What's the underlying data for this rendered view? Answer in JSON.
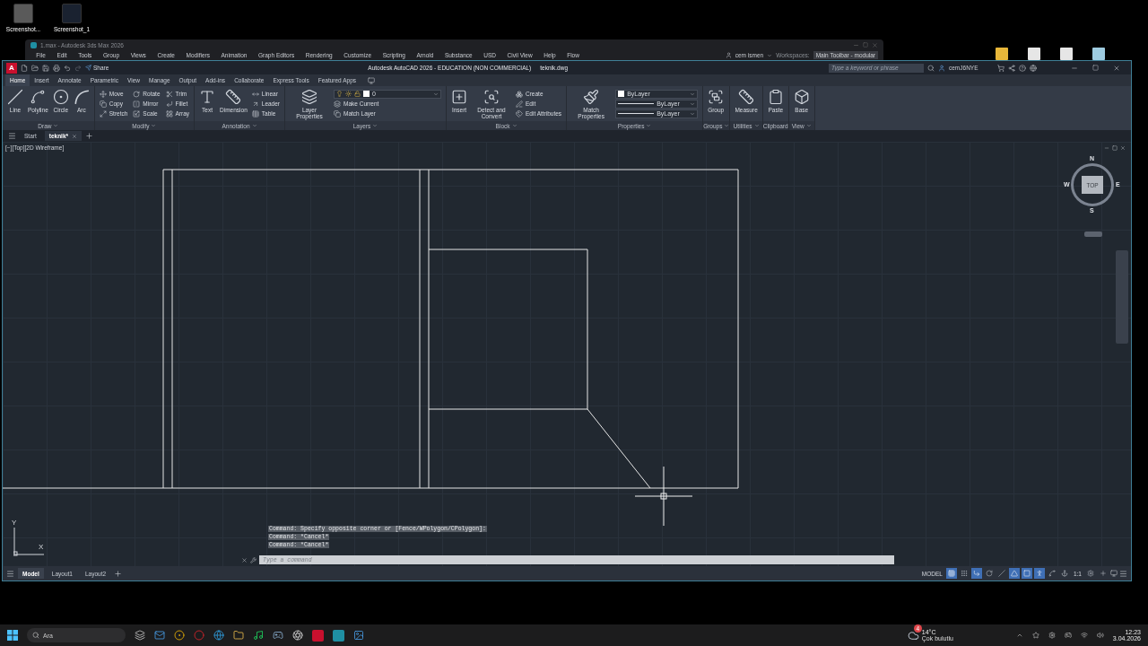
{
  "desktop_icons": [
    {
      "label": "Screenshot..."
    },
    {
      "label": "Screenshot_1"
    }
  ],
  "background_window": {
    "title": "1.max - Autodesk 3ds Max 2026",
    "menu": [
      "File",
      "Edit",
      "Tools",
      "Group",
      "Views",
      "Create",
      "Modifiers",
      "Animation",
      "Graph Editors",
      "Rendering",
      "Customize",
      "Scripting",
      "Arnold",
      "Substance",
      "USD",
      "Civil View",
      "Help",
      "Flow"
    ],
    "user": "cem ismen",
    "workspaces_label": "Workspaces:",
    "workspace": "Main Toolbar - modular"
  },
  "window": {
    "logo": "A",
    "share": "Share",
    "title": "Autodesk AutoCAD 2026 - EDUCATION (NON COMMERCIAL)",
    "file": "teknik.dwg",
    "search": {
      "placeholder": "Type a keyword or phrase"
    },
    "user": "cemJ6NYE"
  },
  "ribbon_tabs": [
    {
      "label": "Home",
      "selected": true
    },
    {
      "label": "Insert",
      "selected": false
    },
    {
      "label": "Annotate",
      "selected": false
    },
    {
      "label": "Parametric",
      "selected": false
    },
    {
      "label": "View",
      "selected": false
    },
    {
      "label": "Manage",
      "selected": false
    },
    {
      "label": "Output",
      "selected": false
    },
    {
      "label": "Add-ins",
      "selected": false
    },
    {
      "label": "Collaborate",
      "selected": false
    },
    {
      "label": "Express Tools",
      "selected": false
    },
    {
      "label": "Featured Apps",
      "selected": false
    }
  ],
  "ribbon_panels": [
    {
      "title": "Draw",
      "dropdown": true,
      "tools": [
        {
          "kind": "large",
          "label": "Line"
        },
        {
          "kind": "large",
          "label": "Polyline"
        },
        {
          "kind": "large",
          "label": "Circle"
        },
        {
          "kind": "large",
          "label": "Arc"
        }
      ]
    },
    {
      "title": "Modify",
      "dropdown": true,
      "tools": [
        {
          "kind": "small",
          "label": "Move"
        },
        {
          "kind": "small",
          "label": "Copy"
        },
        {
          "kind": "small",
          "label": "Stretch"
        },
        {
          "kind": "small",
          "label": "Rotate"
        },
        {
          "kind": "small",
          "label": "Mirror"
        },
        {
          "kind": "small",
          "label": "Scale"
        },
        {
          "kind": "small",
          "label": "Trim"
        },
        {
          "kind": "small",
          "label": "Fillet"
        },
        {
          "kind": "small",
          "label": "Array"
        }
      ]
    },
    {
      "title": "Annotation",
      "dropdown": true,
      "tools": [
        {
          "kind": "large",
          "label": "Text"
        },
        {
          "kind": "large",
          "label": "Dimension"
        },
        {
          "kind": "small",
          "label": "Linear"
        },
        {
          "kind": "small",
          "label": "Leader"
        },
        {
          "kind": "small",
          "label": "Table"
        }
      ]
    },
    {
      "title": "Layers",
      "dropdown": true,
      "tools": [
        {
          "kind": "large",
          "label": "Layer Properties"
        },
        {
          "kind": "combo",
          "value": "0"
        },
        {
          "kind": "small",
          "label": "Make Current"
        },
        {
          "kind": "small",
          "label": "Match Layer"
        }
      ]
    },
    {
      "title": "Block",
      "dropdown": true,
      "tools": [
        {
          "kind": "large",
          "label": "Insert"
        },
        {
          "kind": "large",
          "label": "Detect and Convert"
        },
        {
          "kind": "small",
          "label": "Create"
        },
        {
          "kind": "small",
          "label": "Edit"
        },
        {
          "kind": "small",
          "label": "Edit Attributes"
        }
      ]
    },
    {
      "title": "Properties",
      "dropdown": true,
      "tools": [
        {
          "kind": "large",
          "label": "Match Properties"
        },
        {
          "kind": "combo",
          "value": "ByLayer"
        },
        {
          "kind": "combo",
          "value": "ByLayer"
        },
        {
          "kind": "combo",
          "value": "ByLayer"
        }
      ]
    },
    {
      "title": "Groups",
      "dropdown": true,
      "tools": [
        {
          "kind": "large",
          "label": "Group"
        }
      ]
    },
    {
      "title": "Utilities",
      "dropdown": true,
      "tools": [
        {
          "kind": "large",
          "label": "Measure"
        }
      ]
    },
    {
      "title": "Clipboard",
      "dropdown": false,
      "tools": [
        {
          "kind": "large",
          "label": "Paste"
        }
      ]
    },
    {
      "title": "View",
      "dropdown": true,
      "tools": [
        {
          "kind": "large",
          "label": "Base"
        }
      ]
    }
  ],
  "document_tabs": [
    {
      "label": "Start",
      "selected": false
    },
    {
      "label": "teknik*",
      "selected": true
    }
  ],
  "viewport": {
    "label": "[−][Top][2D Wireframe]",
    "view_cube": {
      "north": "N",
      "south": "S",
      "east": "E",
      "west": "W",
      "face": "TOP"
    },
    "ucs": {
      "x": "X",
      "y": "Y"
    }
  },
  "command_history": [
    "Command: Specify opposite corner or [Fence/WPolygon/CPolygon]:",
    "Command: *Cancel*",
    "Command: *Cancel*"
  ],
  "command_line": {
    "placeholder": "Type a command"
  },
  "layout_tabs": [
    {
      "label": "Model",
      "selected": true
    },
    {
      "label": "Layout1",
      "selected": false
    },
    {
      "label": "Layout2",
      "selected": false
    }
  ],
  "status_bar": {
    "space": "MODEL",
    "scale": "1:1",
    "toggles": [
      {
        "on": true
      },
      {
        "on": false
      },
      {
        "on": true
      },
      {
        "on": false
      },
      {
        "on": false
      },
      {
        "on": true
      },
      {
        "on": true
      },
      {
        "on": true
      },
      {
        "on": false
      },
      {
        "on": false
      },
      {
        "on": false
      },
      {
        "on": false
      }
    ]
  },
  "taskbar": {
    "search": {
      "placeholder": "Ara"
    },
    "weather": {
      "badge": "4",
      "temperature": "14°C",
      "condition": "Çok bulutlu"
    },
    "time": "12:23",
    "date": "3.04.2026"
  }
}
